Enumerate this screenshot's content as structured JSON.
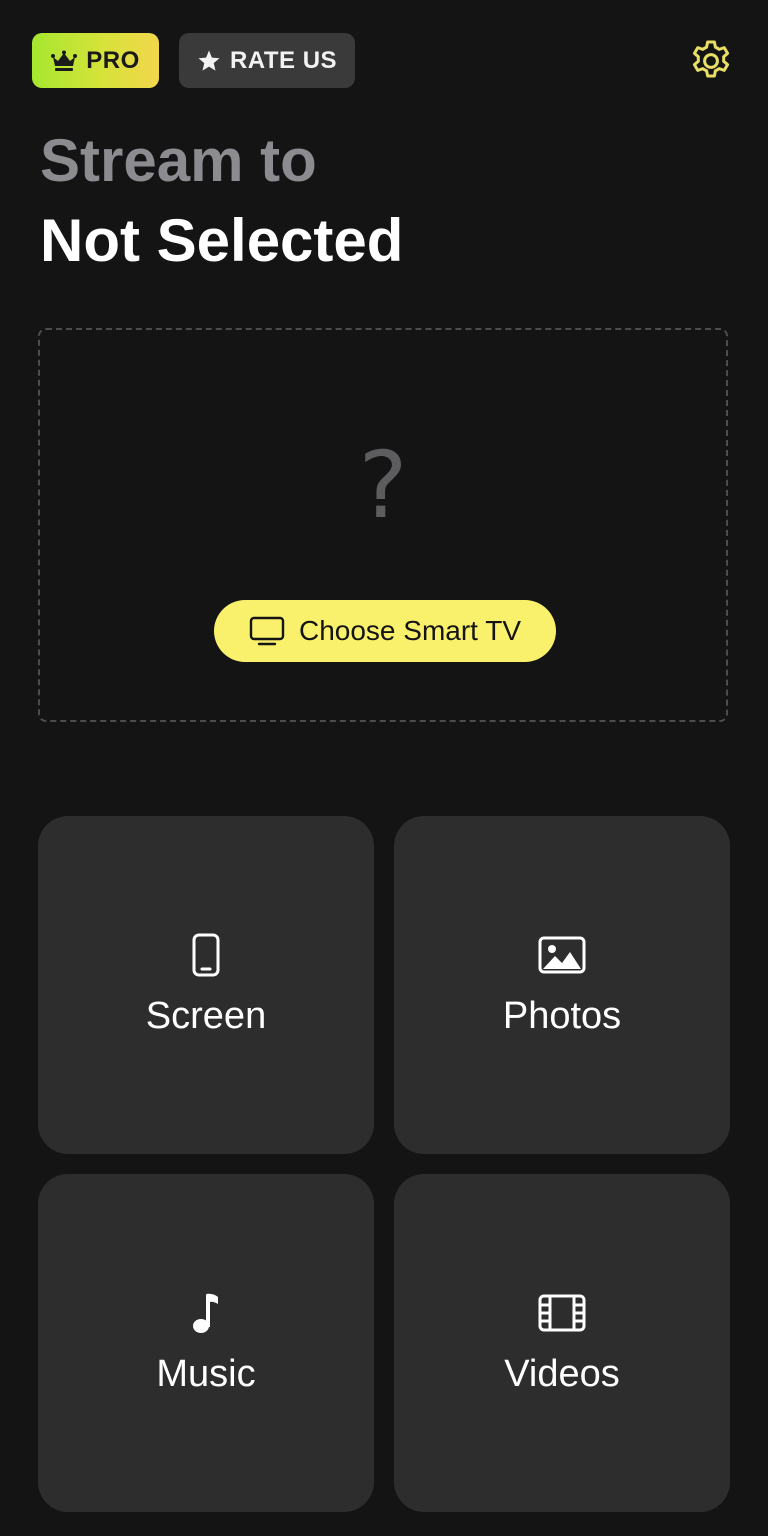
{
  "header": {
    "pro_label": "PRO",
    "rate_label": "RATE US"
  },
  "title": {
    "line1": "Stream to",
    "line2": "Not Selected"
  },
  "device": {
    "placeholder_symbol": "?",
    "choose_label": "Choose Smart TV"
  },
  "tiles": [
    {
      "label": "Screen",
      "icon": "phone-icon"
    },
    {
      "label": "Photos",
      "icon": "photo-icon"
    },
    {
      "label": "Music",
      "icon": "music-note-icon"
    },
    {
      "label": "Videos",
      "icon": "film-icon"
    }
  ],
  "colors": {
    "background": "#141414",
    "tile": "#2d2d2d",
    "accent_yellow": "#f9f06b",
    "pro_gradient_start": "#a6e72f",
    "pro_gradient_end": "#f2d74c",
    "settings_icon": "#e8df63",
    "subtitle_gray": "#8c8c90"
  }
}
